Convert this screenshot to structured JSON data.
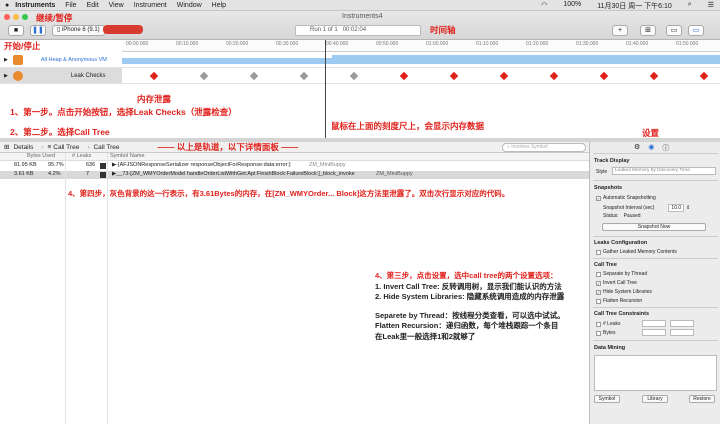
{
  "menubar": {
    "app": "Instruments",
    "items": [
      "File",
      "Edit",
      "View",
      "Instrument",
      "Window",
      "Help"
    ],
    "battery": "100%",
    "clock": "11月30日 周一 下午6:10"
  },
  "toolbar": {
    "annotation_start": "继续/暂停",
    "annotation_stop": "开始/停止",
    "device": "iPhone 6 (9.1)",
    "run": "Run 1 of 1",
    "time": "00:02:04",
    "window_title": "Instruments4",
    "annotation_timeline": "时间轴"
  },
  "ruler": {
    "ticks": [
      "00:00.000",
      "00:10.000",
      "00:20.000",
      "00:30.000",
      "00:40.000",
      "00:50.000",
      "01:00.000",
      "01:10.000",
      "01:20.000",
      "01:30.000",
      "01:40.000",
      "01:50.000"
    ]
  },
  "tracks": {
    "allocations": "All Heap & Anonymous VM",
    "leaks": "Leak Checks"
  },
  "annotations": {
    "leak": "内存泄露",
    "step1": "1、第一步。点击开始按钮，选择Leak Checks（泄露检查）",
    "step2": "2、第二步。选择Call Tree",
    "mouse": "鼠标在上面的刻度尺上，会显示内存数据",
    "settings": "设置",
    "divider": "—— 以上是轨道，以下详情面板 ——",
    "step4": "4、第四步，灰色背景的这一行表示，有3.61Bytes的内存，在[ZM_WMYOrder... Block]这方法里泄露了。双击次行显示对应的代码。",
    "step3_title": "4、第三步，点击设置，选中call tree的两个设置选项：",
    "step3_a": "1. Invert Call Tree: 反转调用树，显示我们能认识的方法",
    "step3_b": "2. Hide System Libraries: 隐藏系统调用造成的内存泄露",
    "sep": "Separete by Thread：按线程分类查看，可以选中试试。",
    "flat1": "Flatten Recursion：递归函数，每个堆栈跟踪一个条目",
    "flat2": "在Leak里一般选择1和2就够了"
  },
  "detailbar": {
    "details": "Details",
    "calltree1": "Call Tree",
    "calltree2": "Call Tree",
    "search": "Involves Symbol"
  },
  "table": {
    "headers": [
      "Bytes Used",
      "# Leaks",
      "Symbol Name"
    ],
    "rows": [
      {
        "bytes": "81.95 KB",
        "pct": "95.7%",
        "leaks": "636",
        "symbol": "▶-[AFJSONResponseSerializer responseObjectForResponse:data:error:]",
        "lib": "ZM_MiniBuppy"
      },
      {
        "bytes": "3.61 KB",
        "pct": "4.2%",
        "leaks": "7",
        "symbol": "▶__73-[ZM_WMYOrderModel handleOrderListWithGet:Api:FinishBlock:FailureBlock:]_block_invoke",
        "lib": "ZM_MiniBuppy"
      }
    ]
  },
  "inspector": {
    "track_display": "Track Display",
    "style_label": "Style",
    "style_value": "Leaked Memory by Discovery Time",
    "snapshots": "Snapshots",
    "auto_snapshot": "Automatic Snapshotting",
    "interval_label": "Snapshot Interval (sec)",
    "interval_value": "10.0",
    "status_label": "Status:",
    "status_value": "Paused",
    "snapshot_now": "Snapshot Now",
    "leaks_config": "Leaks Configuration",
    "gather": "Gather Leaked Memory Contents",
    "call_tree": "Call Tree",
    "opts": [
      "Separate by Thread",
      "Invert Call Tree",
      "Hide System Libraries",
      "Flatten Recursion"
    ],
    "constraints": "Call Tree Constraints",
    "c_leaks": "# Leaks",
    "c_bytes": "Bytes",
    "data_mining": "Data Mining",
    "symbol": "Symbol",
    "library": "Library",
    "restore": "Restore"
  }
}
